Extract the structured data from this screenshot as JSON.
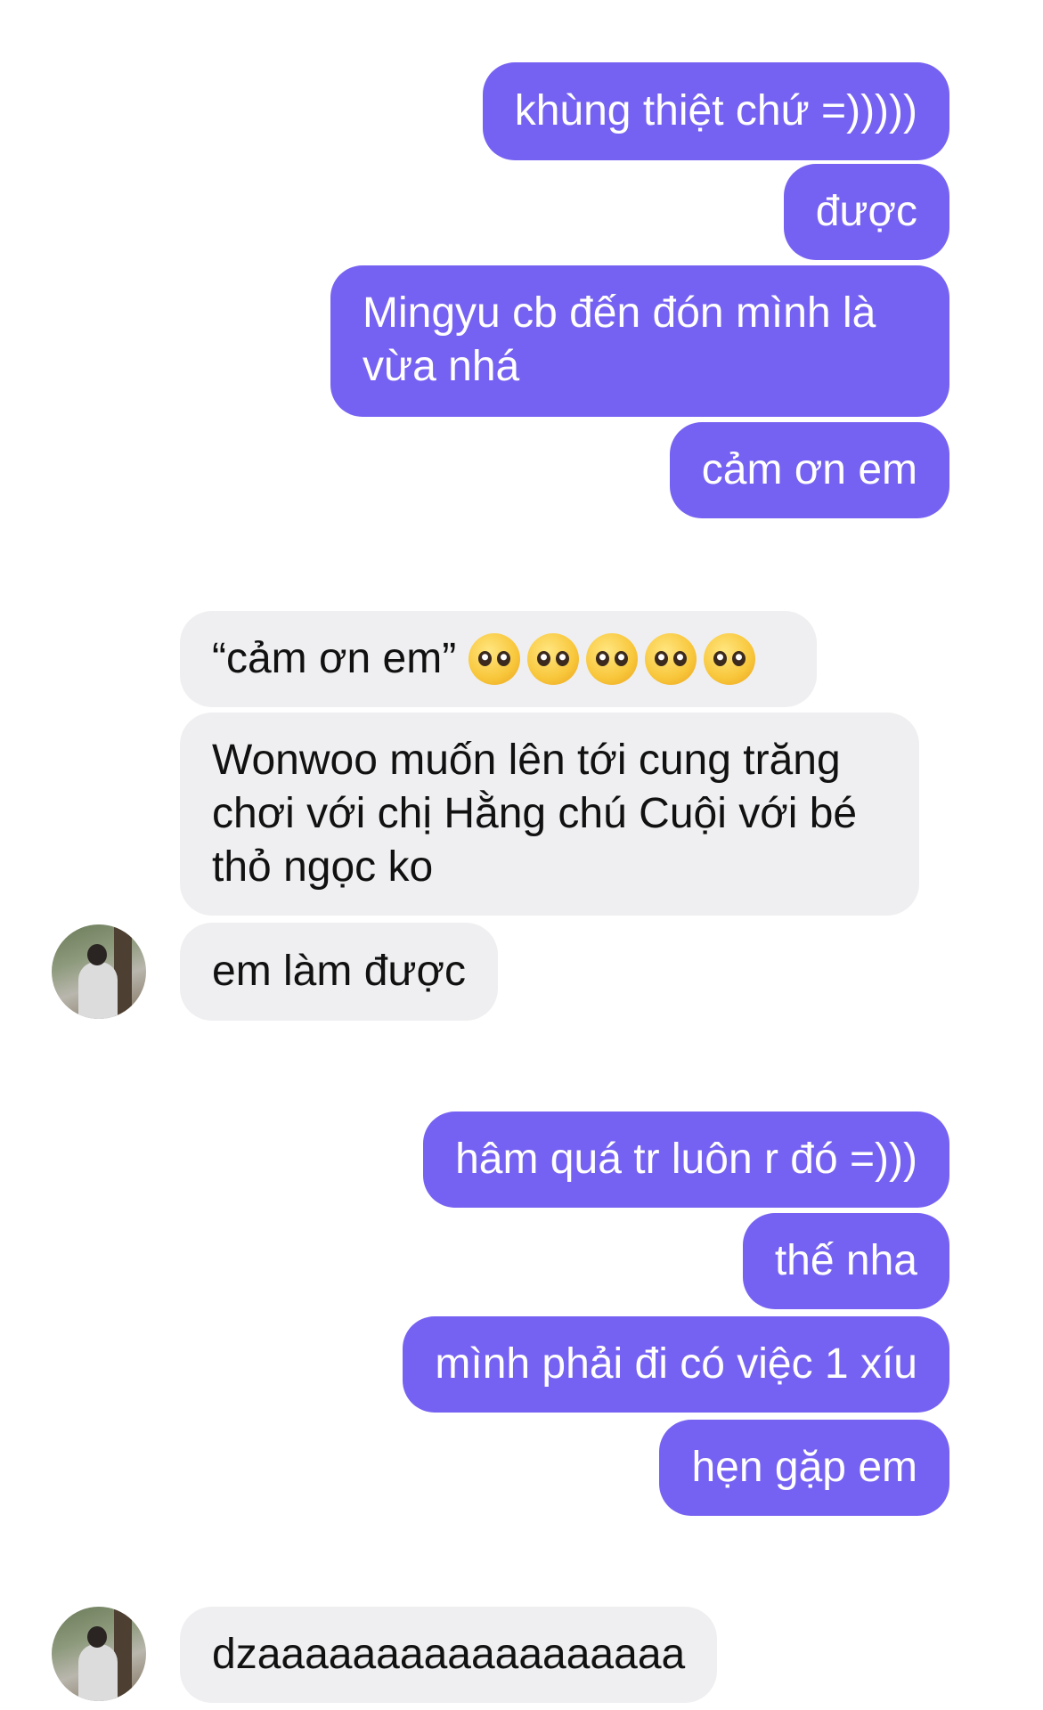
{
  "messages": [
    {
      "id": "m1",
      "side": "out",
      "text": "khùng thiệt chứ =)))))"
    },
    {
      "id": "m2",
      "side": "out",
      "text": "được"
    },
    {
      "id": "m3",
      "side": "out",
      "text": "Mingyu cb đến đón mình là vừa nhá"
    },
    {
      "id": "m4",
      "side": "out",
      "text": "cảm ơn em"
    },
    {
      "id": "m5",
      "side": "in",
      "text": "“cảm ơn em”",
      "emoji": [
        "pleading-face",
        "pleading-face",
        "pleading-face",
        "pleading-face",
        "pleading-face"
      ]
    },
    {
      "id": "m6",
      "side": "in",
      "text": "Wonwoo muốn lên tới cung trăng chơi với chị Hằng chú Cuội với bé thỏ ngọc ko"
    },
    {
      "id": "m7",
      "side": "in",
      "text": "em làm được"
    },
    {
      "id": "m8",
      "side": "out",
      "text": "hâm quá tr luôn r đó =)))"
    },
    {
      "id": "m9",
      "side": "out",
      "text": "thế nha"
    },
    {
      "id": "m10",
      "side": "out",
      "text": "mình phải đi có việc 1 xíu"
    },
    {
      "id": "m11",
      "side": "out",
      "text": "hẹn gặp em"
    },
    {
      "id": "m12",
      "side": "in",
      "text": "dzaaaaaaaaaaaaaaaaaa"
    }
  ],
  "colors": {
    "outgoing_bubble": "#7662f2",
    "incoming_bubble": "#efeff1",
    "outgoing_text": "#ffffff",
    "incoming_text": "#111111"
  }
}
